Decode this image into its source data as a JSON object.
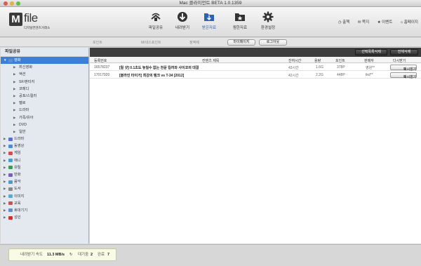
{
  "window": {
    "title": "Mac 클라이언트 BETA 1.0.1359"
  },
  "logo": {
    "mark": "M",
    "word": "file",
    "subtitle": "디지털컨텐츠거래소"
  },
  "toolbar": {
    "buttons": [
      {
        "label": "파일공유",
        "icon": "share-icon"
      },
      {
        "label": "내려받기",
        "icon": "download-icon"
      },
      {
        "label": "받은자료",
        "icon": "received-folder-icon"
      },
      {
        "label": "찜한자료",
        "icon": "saved-folder-icon"
      },
      {
        "label": "환경설정",
        "icon": "gear-icon"
      }
    ],
    "right_links": [
      "출첵",
      "쪽지",
      "이벤트",
      "홈페이지"
    ]
  },
  "subbar": {
    "points": "포인트",
    "mileage": "M/내스포인트",
    "fixed": "정액제",
    "mypage": "마이페이지",
    "logout": "로그아웃"
  },
  "sidebar": {
    "title": "파일공유",
    "items": [
      {
        "label": "영화",
        "expanded": true,
        "color": "#5b8fd6"
      },
      {
        "label": "최신영화"
      },
      {
        "label": "액션"
      },
      {
        "label": "SF/판타지"
      },
      {
        "label": "코메디"
      },
      {
        "label": "공포/스릴러"
      },
      {
        "label": "멜로"
      },
      {
        "label": "드라마"
      },
      {
        "label": "가족/유아"
      },
      {
        "label": "DVD"
      },
      {
        "label": "일반"
      },
      {
        "label": "드라마",
        "color": "#5b6fd0"
      },
      {
        "label": "동영상",
        "color": "#4b8fd0"
      },
      {
        "label": "게임",
        "color": "#d05050"
      },
      {
        "label": "애니",
        "color": "#4a9ad8"
      },
      {
        "label": "유틸",
        "color": "#3c9a5a"
      },
      {
        "label": "만화",
        "color": "#7a5cc8"
      },
      {
        "label": "음악",
        "color": "#4a9ad8"
      },
      {
        "label": "도서",
        "color": "#8a8a8a"
      },
      {
        "label": "이미지",
        "color": "#4ab0d8"
      },
      {
        "label": "교육",
        "color": "#d05050"
      },
      {
        "label": "휴대기기",
        "color": "#5b8fd6"
      },
      {
        "label": "성인",
        "color": "#d03030"
      }
    ]
  },
  "main": {
    "buttons": {
      "delete_selected": "선택목록삭제",
      "delete_all": "전체삭제"
    },
    "columns": [
      "등록번호",
      "컨텐츠 제목",
      "잔여시간",
      "용량",
      "포인트",
      "판매자",
      "다시받기"
    ],
    "rows": [
      {
        "id": "16578237",
        "title": "[릴 샷] 0.1초도 놓칠수 없는 천문 킬러와 사이코의 대결",
        "remaining": "43시간",
        "size": "1.6G",
        "points": "378P",
        "seller": "영원**",
        "action": "다시받기"
      },
      {
        "id": "17017920",
        "title": "[블라인 타이거] 최강의 탱크 vs T-34 [2012]",
        "remaining": "42시간",
        "size": "2.2G",
        "points": "448P",
        "seller": "tkd**",
        "action": "다시받기"
      }
    ]
  },
  "status": {
    "speed_label": "내려받기 속도",
    "speed_value": "11.3 MB/s",
    "wait_label": "대기중",
    "wait_value": "2",
    "done_label": "완료",
    "done_value": "7"
  }
}
